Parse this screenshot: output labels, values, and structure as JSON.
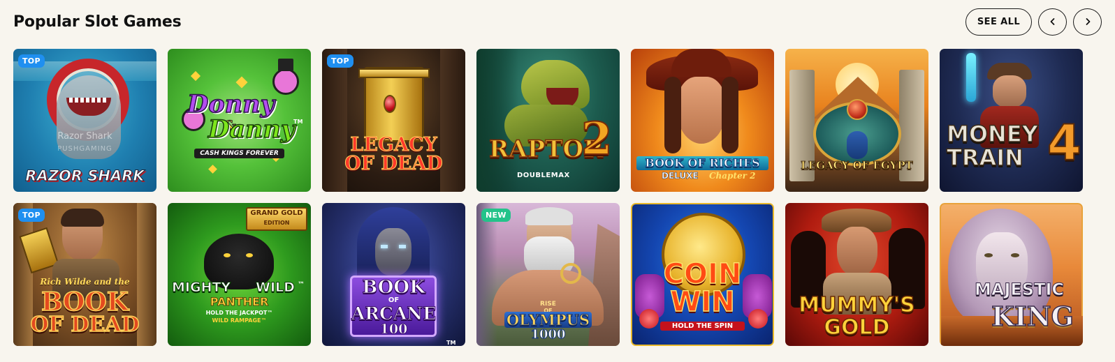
{
  "header": {
    "title": "Popular Slot Games",
    "see_all_label": "SEE ALL"
  },
  "icons": {
    "prev": "chevron-left-icon",
    "next": "chevron-right-icon"
  },
  "colors": {
    "background": "#f8f5ee",
    "badge_top": "#1f8ff0",
    "badge_new": "#23c38a"
  },
  "games": [
    {
      "title": "RAZOR SHARK",
      "badge": "TOP",
      "watermark": "Razor Shark",
      "provider_mark": "PUSHGAMING"
    },
    {
      "title_line1": "Donny",
      "title_amp": "&",
      "title_line2": "Danny",
      "tm": "TM",
      "subtitle": "CASH KINGS FOREVER",
      "badge": ""
    },
    {
      "title_line1": "LEGACY",
      "title_line2": "OF DEAD",
      "badge": "TOP"
    },
    {
      "title": "RAPTOR",
      "title_num": "2",
      "subtitle": "DOUBLEMAX",
      "badge": ""
    },
    {
      "title": "BOOK OF RICHES",
      "subtitle": "DELUXE",
      "chapter": "Chapter 2",
      "badge": ""
    },
    {
      "title": "LEGACY OF EGYPT",
      "badge": ""
    },
    {
      "title_line1": "MONEY",
      "title_line2": "TRAIN",
      "title_num": "4",
      "badge": ""
    },
    {
      "pre_title": "Rich Wilde and the",
      "title_line1": "BOOK",
      "title_line2": "OF DEAD",
      "badge": "TOP"
    },
    {
      "edition_line1": "GRAND GOLD",
      "edition_line2": "EDITION",
      "title_line1": "MIGHTY",
      "title_line1b": "WILD",
      "tm": "™",
      "title_line2": "PANTHER",
      "subtitle1": "HOLD THE JACKPOT™",
      "subtitle2": "WILD RAMPAGE™",
      "badge": ""
    },
    {
      "title_line1": "BOOK",
      "title_of": "OF",
      "title_line2": "ARCANE",
      "title_num": "100",
      "tm": "TM",
      "badge": ""
    },
    {
      "pre_title": "RISE",
      "title_of": "OF",
      "title": "OLYMPUS",
      "title_num": "1000",
      "badge": "NEW"
    },
    {
      "title_line1": "COIN",
      "title_line2": "WIN",
      "subtitle": "HOLD THE SPIN",
      "badge": ""
    },
    {
      "title_line1": "MUMMY'S",
      "title_line2": "GOLD",
      "badge": ""
    },
    {
      "title_line1": "MAJESTIC",
      "title_line2": "KING",
      "badge": ""
    }
  ]
}
